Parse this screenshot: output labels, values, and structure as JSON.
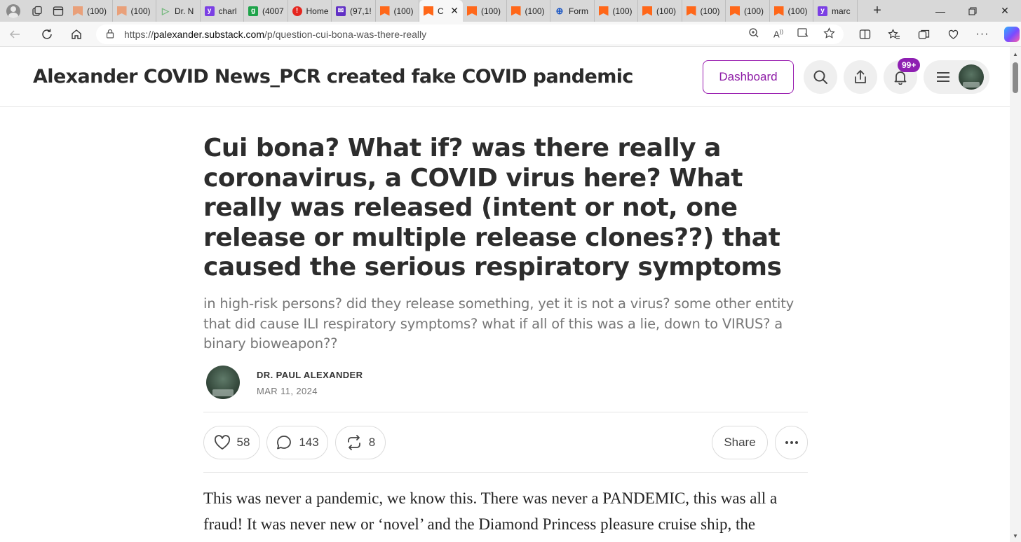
{
  "browser": {
    "tabs": [
      {
        "label": "(100)",
        "icon": "substack-icon"
      },
      {
        "label": "(100)",
        "icon": "substack-icon"
      },
      {
        "label": "Dr. N",
        "icon": "play-icon"
      },
      {
        "label": "charl",
        "icon": "yahoo-icon"
      },
      {
        "label": "(4007",
        "icon": "green-g-icon"
      },
      {
        "label": "Home",
        "icon": "red-icon"
      },
      {
        "label": "(97,1!",
        "icon": "mail-icon"
      },
      {
        "label": "(100)",
        "icon": "substack-icon"
      },
      {
        "label": "C",
        "icon": "substack-icon",
        "active": true
      },
      {
        "label": "(100)",
        "icon": "substack-icon"
      },
      {
        "label": "(100)",
        "icon": "substack-icon"
      },
      {
        "label": "Form",
        "icon": "globe-icon"
      },
      {
        "label": "(100)",
        "icon": "substack-icon"
      },
      {
        "label": "(100)",
        "icon": "substack-icon"
      },
      {
        "label": "(100)",
        "icon": "substack-icon"
      },
      {
        "label": "(100)",
        "icon": "substack-icon"
      },
      {
        "label": "(100)",
        "icon": "substack-icon"
      },
      {
        "label": "marc",
        "icon": "yahoo-icon"
      }
    ],
    "url_prefix": "https://",
    "url_host": "palexander.substack.com",
    "url_path": "/p/question-cui-bona-was-there-really"
  },
  "site": {
    "title": "Alexander COVID News_PCR created fake COVID pandemic",
    "dashboard_label": "Dashboard",
    "notification_badge": "99+"
  },
  "post": {
    "title": "Cui bona? What if? was there really a coronavirus, a COVID virus here? What really was released (intent or not, one release or multiple release clones??) that caused the serious respiratory symptoms",
    "subtitle": "in high-risk persons? did they release something, yet it is not a virus? some other entity that did cause ILI respiratory symptoms? what if all of this was a lie, down to VIRUS? a binary bioweapon??",
    "author": "DR. PAUL ALEXANDER",
    "date": "MAR 11, 2024",
    "likes": "58",
    "comments": "143",
    "restacks": "8",
    "share_label": "Share",
    "body": "This was never a pandemic, we know this. There was never a PANDEMIC, this was all a fraud! It was never new or ‘novel’ and the Diamond Princess pleasure cruise ship, the"
  },
  "colors": {
    "accent": "#8e1fb2",
    "substack_orange": "#ff6719"
  }
}
